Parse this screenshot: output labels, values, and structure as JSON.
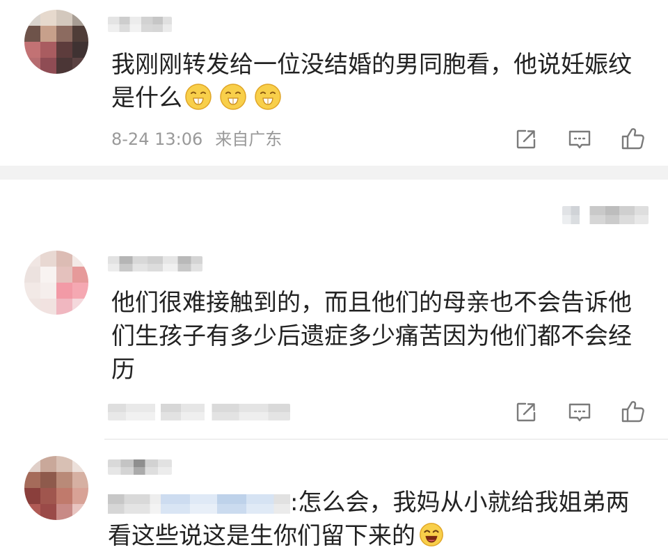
{
  "colors": {
    "text": "#222222",
    "meta": "#999999",
    "icon": "#7a7a7a",
    "section_band": "#f2f2f2",
    "divider": "#efefef"
  },
  "comments": [
    {
      "text": "我刚刚转发给一位没结婚的男同胞看，他说妊娠纹是什么",
      "emojis": [
        "grin-emoji",
        "grin-emoji",
        "grin-emoji"
      ],
      "time": "8-24 13:06",
      "location": "来自广东",
      "actions": [
        "share-icon",
        "comment-icon",
        "like-icon"
      ]
    },
    {
      "text": "他们很难接触到的，而且他们的母亲也不会告诉他们生孩子有多少后遗症多少痛苦因为他们都不会经历",
      "actions": [
        "share-icon",
        "comment-icon",
        "like-icon"
      ]
    },
    {
      "text": ":怎么会，我妈从小就给我姐弟两看这些说这是生你们留下来的",
      "emojis": [
        "laugh-cry-emoji"
      ]
    }
  ]
}
